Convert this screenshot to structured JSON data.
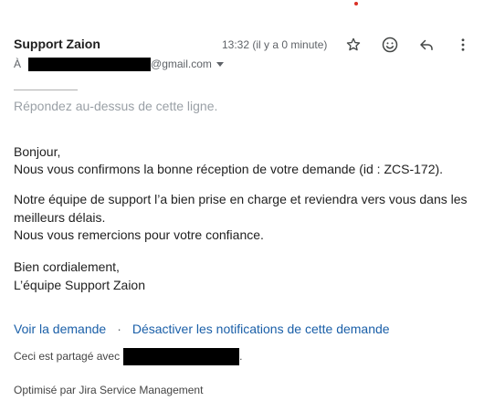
{
  "header": {
    "sender_name": "Support Zaion",
    "timestamp": "13:32 (il y a 0 minute)",
    "icons": [
      "star-icon",
      "emoji-icon",
      "reply-icon",
      "more-vert-icon"
    ]
  },
  "recipient": {
    "to_label": "À",
    "email_domain": "@gmail.com"
  },
  "reply_hint": "Répondez au-dessus de cette ligne.",
  "body": {
    "greeting": "Bonjour,",
    "confirmation": "Nous vous confirmons la bonne réception de votre demande (id : ZCS-172).",
    "support_line1": "Notre équipe de support l’a bien prise en charge et reviendra vers vous dans les",
    "support_line2": "meilleurs délais.",
    "thanks": "Nous vous remercions pour votre confiance.",
    "closing": "Bien cordialement,",
    "signature": "L’équipe Support Zaion"
  },
  "links": {
    "view_request": "Voir la demande",
    "separator": "·",
    "disable_notifications": "Désactiver les notifications de cette demande"
  },
  "footer": {
    "shared_with": "Ceci est partagé avec",
    "shared_suffix": ".",
    "powered_by": "Optimisé par Jira Service Management"
  },
  "colors": {
    "link": "#1a5fa8",
    "muted": "#5f6368",
    "hint": "#9aa0a6",
    "indicator_dot": "#d93025"
  }
}
